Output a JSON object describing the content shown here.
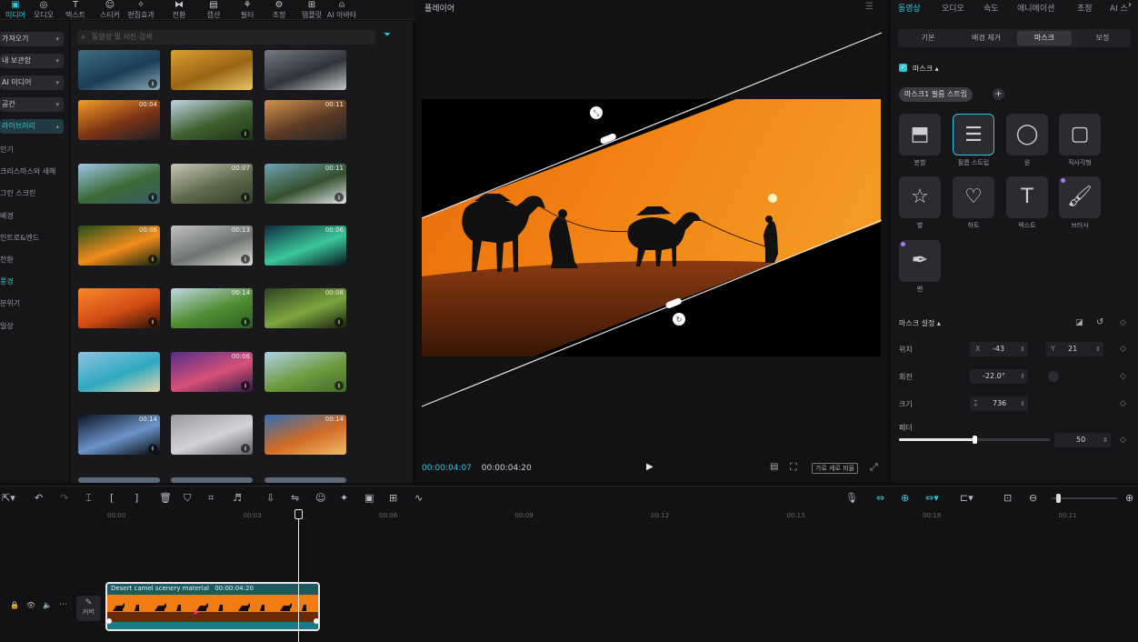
{
  "toolbar": {
    "items": [
      {
        "label": "미디어",
        "icon": "media-icon",
        "active": true
      },
      {
        "label": "오디오",
        "icon": "audio-icon"
      },
      {
        "label": "텍스트",
        "icon": "text-icon"
      },
      {
        "label": "스티커",
        "icon": "sticker-icon"
      },
      {
        "label": "편집효과",
        "icon": "effects-icon"
      },
      {
        "label": "전환",
        "icon": "transition-icon"
      },
      {
        "label": "캡션",
        "icon": "caption-icon"
      },
      {
        "label": "필터",
        "icon": "filter-icon"
      },
      {
        "label": "조정",
        "icon": "adjust-icon"
      },
      {
        "label": "템플릿",
        "icon": "template-icon"
      },
      {
        "label": "AI 아바타",
        "icon": "ai-avatar-icon"
      }
    ]
  },
  "sidebar": {
    "dropdowns": [
      "가져오기",
      "내 보관함",
      "AI 미디어",
      "공간",
      "라이브러리"
    ],
    "items": [
      "인기",
      "크리스마스와 새해",
      "그린 스크린",
      "배경",
      "인트로&엔드",
      "전환",
      "풍경",
      "분위기",
      "일상"
    ],
    "active_item": "풍경"
  },
  "media": {
    "search_placeholder": "동영상 및 사진 검색",
    "thumbs": [
      {
        "dur": "",
        "dl": true,
        "colors": [
          "#3d6f7f",
          "#1b3d55",
          "#87a9b3"
        ]
      },
      {
        "dur": "",
        "dl": false,
        "colors": [
          "#d9a030",
          "#9b6414",
          "#e7c76a"
        ]
      },
      {
        "dur": "",
        "dl": false,
        "colors": [
          "#747a82",
          "#2f343a",
          "#c3c6c8"
        ]
      },
      {
        "dur": "00:04",
        "dl": false,
        "colors": [
          "#f39b2a",
          "#7b3415",
          "#1c1d27"
        ]
      },
      {
        "dur": "",
        "dl": true,
        "colors": [
          "#c2d6e8",
          "#40602f",
          "#1c3518"
        ]
      },
      {
        "dur": "00:11",
        "dl": false,
        "colors": [
          "#d4934c",
          "#5b3a24",
          "#242428"
        ]
      },
      {
        "dur": "",
        "dl": true,
        "colors": [
          "#9cc6e7",
          "#3c6a36",
          "#395b6b"
        ]
      },
      {
        "dur": "00:07",
        "dl": true,
        "colors": [
          "#c8c7b6",
          "#5d6a4a",
          "#313d27"
        ]
      },
      {
        "dur": "00:11",
        "dl": true,
        "colors": [
          "#6ea3b1",
          "#36502e",
          "#dfe7e8"
        ]
      },
      {
        "dur": "00:06",
        "dl": true,
        "colors": [
          "#1f4f1b",
          "#f28c1c",
          "#0d2410"
        ]
      },
      {
        "dur": "00:13",
        "dl": true,
        "colors": [
          "#c2c2c0",
          "#6e7470",
          "#deded9"
        ]
      },
      {
        "dur": "00:06",
        "dl": false,
        "colors": [
          "#0c2a3c",
          "#3ac79b",
          "#0a1421"
        ]
      },
      {
        "dur": "",
        "dl": true,
        "colors": [
          "#f8892c",
          "#d24b14",
          "#2a1108"
        ]
      },
      {
        "dur": "00:14",
        "dl": true,
        "colors": [
          "#c3d6e5",
          "#4f8d32",
          "#2e5f22"
        ]
      },
      {
        "dur": "00:08",
        "dl": true,
        "colors": [
          "#2d4321",
          "#7da63d",
          "#14200f"
        ]
      },
      {
        "dur": "",
        "dl": false,
        "colors": [
          "#8fc3e0",
          "#2fa9c0",
          "#e7d5ad"
        ]
      },
      {
        "dur": "00:06",
        "dl": true,
        "colors": [
          "#542e8a",
          "#d85078",
          "#2b1a48"
        ]
      },
      {
        "dur": "",
        "dl": true,
        "colors": [
          "#b0d1e9",
          "#6f9b3f",
          "#3f6a2a"
        ]
      },
      {
        "dur": "00:14",
        "dl": true,
        "colors": [
          "#0c1324",
          "#6c94c9",
          "#030509"
        ]
      },
      {
        "dur": "",
        "dl": true,
        "colors": [
          "#9a9ba1",
          "#d2d3d6",
          "#5d5e62"
        ]
      },
      {
        "dur": "00:14",
        "dl": false,
        "colors": [
          "#2e6fb4",
          "#d36b24",
          "#efbc6a"
        ]
      }
    ]
  },
  "player": {
    "title": "플레이어",
    "current_time": "00:00:04:07",
    "total_time": "00:00:04:20",
    "ratio_label": "가로 세로 비율"
  },
  "right_panel": {
    "tabs": [
      "동영상",
      "오디오",
      "속도",
      "애니메이션",
      "조정",
      "AI 스"
    ],
    "active_tab": "동영상",
    "subtabs": [
      "기본",
      "배경 제거",
      "마스크",
      "보정"
    ],
    "active_subtab": "마스크",
    "mask_label": "마스크",
    "mask_enabled": true,
    "mask_chip": "마스크1 필름 스트립",
    "masks": [
      {
        "label": "분할",
        "icon": "split-mask-icon"
      },
      {
        "label": "필름 스트립",
        "icon": "filmstrip-mask-icon",
        "selected": true
      },
      {
        "label": "원",
        "icon": "circle-mask-icon"
      },
      {
        "label": "직사각형",
        "icon": "rectangle-mask-icon"
      },
      {
        "label": "별",
        "icon": "star-mask-icon"
      },
      {
        "label": "하트",
        "icon": "heart-mask-icon"
      },
      {
        "label": "텍스트",
        "icon": "text-mask-icon"
      },
      {
        "label": "브러시",
        "icon": "brush-mask-icon"
      },
      {
        "label": "펜",
        "icon": "pen-mask-icon"
      }
    ],
    "settings_title": "마스크 설정",
    "position_label": "위치",
    "x_label": "X",
    "x_value": "-43",
    "y_label": "Y",
    "y_value": "21",
    "rotation_label": "회전",
    "rotation_value": "-22.0°",
    "size_label": "크기",
    "size_value": "736",
    "feather_label": "페더",
    "feather_value": "50",
    "feather_fraction": 0.5
  },
  "timeline": {
    "ruler": [
      "00:00",
      "00:03",
      "00:06",
      "00:09",
      "00:12",
      "00:15",
      "00:18",
      "00:21"
    ],
    "clip_title": "Desert camel scenery material",
    "clip_duration": "00:00:04:20",
    "cover_label": "커버",
    "zoom_fraction": 0.1
  },
  "colors": {
    "accent": "#2cc9d9",
    "sky_orange": "#f07c12",
    "clip_bg": "#1d5962"
  }
}
